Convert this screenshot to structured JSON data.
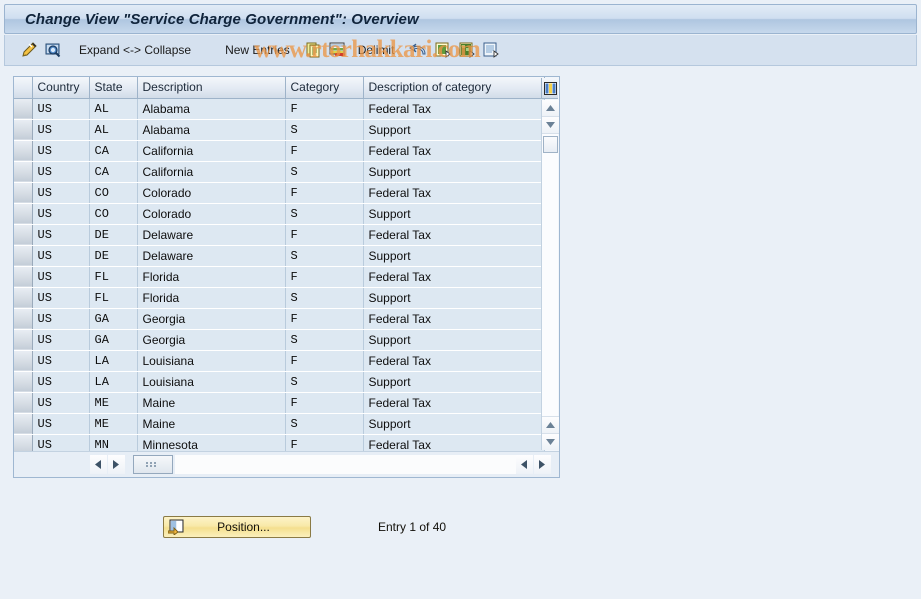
{
  "window": {
    "title": "Change View \"Service Charge Government\": Overview"
  },
  "toolbar": {
    "items": [
      {
        "name": "change-display-icon",
        "label": ""
      },
      {
        "name": "display-detail-icon",
        "label": ""
      },
      {
        "name": "expand-collapse",
        "label": "Expand <-> Collapse"
      },
      {
        "name": "new-entries",
        "label": "New Entries"
      },
      {
        "name": "copy-as-icon",
        "label": ""
      },
      {
        "name": "delete-icon",
        "label": ""
      },
      {
        "name": "delimit",
        "label": "Delimit"
      },
      {
        "name": "undo-icon",
        "label": ""
      },
      {
        "name": "select-all-icon",
        "label": ""
      },
      {
        "name": "select-block-icon",
        "label": ""
      },
      {
        "name": "deselect-all-icon",
        "label": ""
      }
    ],
    "expand_collapse_label": "Expand <-> Collapse",
    "new_entries_label": "New Entries",
    "delimit_label": "Delimit"
  },
  "table": {
    "columns": [
      {
        "key": "country",
        "label": "Country"
      },
      {
        "key": "state",
        "label": "State"
      },
      {
        "key": "desc",
        "label": "Description"
      },
      {
        "key": "category",
        "label": "Category"
      },
      {
        "key": "dcat",
        "label": "Description of category"
      }
    ],
    "rows": [
      {
        "country": "US",
        "state": "AL",
        "desc": "Alabama",
        "category": "F",
        "dcat": "Federal Tax"
      },
      {
        "country": "US",
        "state": "AL",
        "desc": "Alabama",
        "category": "S",
        "dcat": "Support"
      },
      {
        "country": "US",
        "state": "CA",
        "desc": "California",
        "category": "F",
        "dcat": "Federal Tax"
      },
      {
        "country": "US",
        "state": "CA",
        "desc": "California",
        "category": "S",
        "dcat": "Support"
      },
      {
        "country": "US",
        "state": "CO",
        "desc": "Colorado",
        "category": "F",
        "dcat": "Federal Tax"
      },
      {
        "country": "US",
        "state": "CO",
        "desc": "Colorado",
        "category": "S",
        "dcat": "Support"
      },
      {
        "country": "US",
        "state": "DE",
        "desc": "Delaware",
        "category": "F",
        "dcat": "Federal Tax"
      },
      {
        "country": "US",
        "state": "DE",
        "desc": "Delaware",
        "category": "S",
        "dcat": "Support"
      },
      {
        "country": "US",
        "state": "FL",
        "desc": "Florida",
        "category": "F",
        "dcat": "Federal Tax"
      },
      {
        "country": "US",
        "state": "FL",
        "desc": "Florida",
        "category": "S",
        "dcat": "Support"
      },
      {
        "country": "US",
        "state": "GA",
        "desc": "Georgia",
        "category": "F",
        "dcat": "Federal Tax"
      },
      {
        "country": "US",
        "state": "GA",
        "desc": "Georgia",
        "category": "S",
        "dcat": "Support"
      },
      {
        "country": "US",
        "state": "LA",
        "desc": "Louisiana",
        "category": "F",
        "dcat": "Federal Tax"
      },
      {
        "country": "US",
        "state": "LA",
        "desc": "Louisiana",
        "category": "S",
        "dcat": "Support"
      },
      {
        "country": "US",
        "state": "ME",
        "desc": "Maine",
        "category": "F",
        "dcat": "Federal Tax"
      },
      {
        "country": "US",
        "state": "ME",
        "desc": "Maine",
        "category": "S",
        "dcat": "Support"
      },
      {
        "country": "US",
        "state": "MN",
        "desc": "Minnesota",
        "category": "F",
        "dcat": "Federal Tax"
      }
    ]
  },
  "footer": {
    "position_label": "Position...",
    "entry_counter": "Entry 1 of 40"
  },
  "watermark": {
    "text": "www.rtorhakkari.com"
  },
  "colors": {
    "title_accent": "#afc6e0",
    "row_blue": "#dde8f2",
    "button_yellow": "#f4df8e",
    "watermark_orange": "#eb9646"
  }
}
